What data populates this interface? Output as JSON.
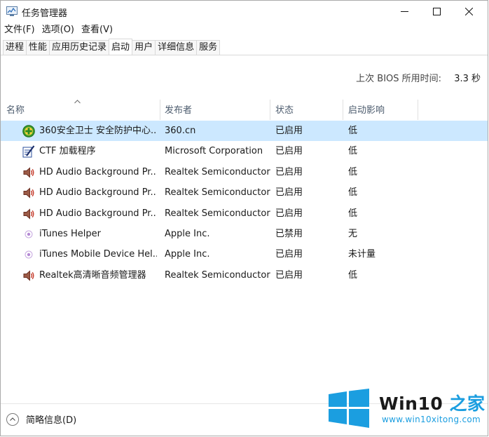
{
  "window": {
    "title": "任务管理器"
  },
  "menu": [
    {
      "label": "文件(F)"
    },
    {
      "label": "选项(O)"
    },
    {
      "label": "查看(V)"
    }
  ],
  "tabs": [
    {
      "label": "进程"
    },
    {
      "label": "性能"
    },
    {
      "label": "应用历史记录"
    },
    {
      "label": "启动",
      "active": true
    },
    {
      "label": "用户"
    },
    {
      "label": "详细信息"
    },
    {
      "label": "服务"
    }
  ],
  "bios": {
    "label": "上次 BIOS 所用时间:",
    "value": "3.3 秒"
  },
  "columns": {
    "name": "名称",
    "publisher": "发布者",
    "status": "状态",
    "impact": "启动影响"
  },
  "rows": [
    {
      "icon": "360-shield-icon",
      "name": "360安全卫士 安全防护中心...",
      "publisher": "360.cn",
      "status": "已启用",
      "impact": "低",
      "selected": true
    },
    {
      "icon": "ctf-loader-icon",
      "name": "CTF 加载程序",
      "publisher": "Microsoft Corporation",
      "status": "已启用",
      "impact": "低"
    },
    {
      "icon": "speaker-icon",
      "name": "HD Audio Background Pr...",
      "publisher": "Realtek Semiconductor",
      "status": "已启用",
      "impact": "低"
    },
    {
      "icon": "speaker-icon",
      "name": "HD Audio Background Pr...",
      "publisher": "Realtek Semiconductor",
      "status": "已启用",
      "impact": "低"
    },
    {
      "icon": "speaker-icon",
      "name": "HD Audio Background Pr...",
      "publisher": "Realtek Semiconductor",
      "status": "已启用",
      "impact": "低"
    },
    {
      "icon": "itunes-icon",
      "name": "iTunes Helper",
      "publisher": "Apple Inc.",
      "status": "已禁用",
      "impact": "无"
    },
    {
      "icon": "itunes-icon",
      "name": "iTunes Mobile Device Hel...",
      "publisher": "Apple Inc.",
      "status": "已启用",
      "impact": "未计量"
    },
    {
      "icon": "speaker-icon",
      "name": "Realtek高清晰音频管理器",
      "publisher": "Realtek Semiconductor",
      "status": "已启用",
      "impact": "低"
    }
  ],
  "footer": {
    "label": "简略信息(D)"
  },
  "watermark": {
    "title_a": "Win10",
    "title_b": " 之家",
    "url": "www.win10xitong.com"
  },
  "colors": {
    "selected_row": "#cce8ff",
    "header_text": "#4d5c6e",
    "watermark_blue": "#1b9ee0"
  }
}
